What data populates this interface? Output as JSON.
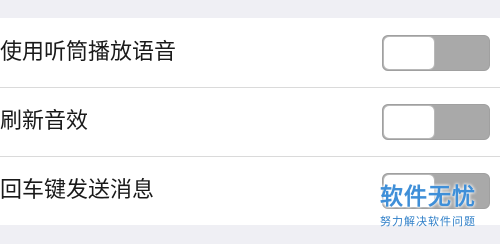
{
  "settings": {
    "items": [
      {
        "label": "使用听筒播放语音",
        "enabled": false
      },
      {
        "label": "刷新音效",
        "enabled": false
      },
      {
        "label": "回车键发送消息",
        "enabled": false
      }
    ]
  },
  "watermark": {
    "title": "软件无忧",
    "subtitle": "努力解决软件问题"
  },
  "colors": {
    "background": "#efeff4",
    "row_background": "#ffffff",
    "toggle_off_track": "#a9a9a9",
    "toggle_knob": "#ffffff",
    "watermark": "#3f8fd8"
  }
}
